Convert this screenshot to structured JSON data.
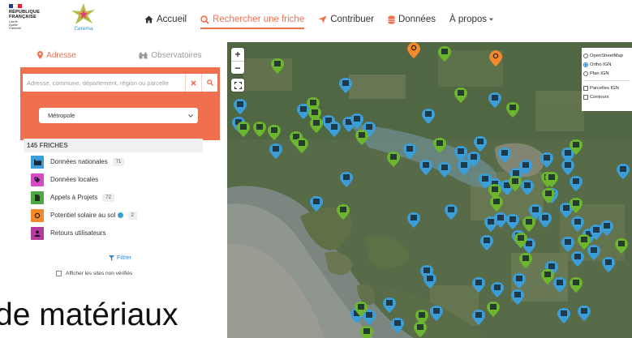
{
  "brand": {
    "rf_lines": [
      "RÉPUBLIQUE",
      "FRANÇAISE"
    ],
    "rf_motto": [
      "Liberté",
      "Égalité",
      "Fraternité"
    ],
    "cerema": "Cerema",
    "colors": {
      "accent": "#ef6f4f",
      "blue": "#3b9ed8",
      "green": "#6bb52f"
    }
  },
  "nav": {
    "items": [
      {
        "label": "Accueil",
        "icon": "home-icon"
      },
      {
        "label": "Rechercher une friche",
        "icon": "search-icon",
        "active": true
      },
      {
        "label": "Contribuer",
        "icon": "send-icon"
      },
      {
        "label": "Données",
        "icon": "database-icon"
      },
      {
        "label": "À propos",
        "icon": "chevron-down-icon"
      }
    ]
  },
  "sidebar": {
    "tabs": [
      {
        "label": "Adresse",
        "icon": "map-marker-icon",
        "active": true
      },
      {
        "label": "Observatoires",
        "icon": "binoculars-icon"
      }
    ],
    "search": {
      "placeholder": "Adresse, commune, département, région ou parcelle"
    },
    "region": {
      "selected": "Métropole"
    },
    "legend": {
      "title": "145 FRICHES",
      "items": [
        {
          "label": "Données nationales",
          "count": "71",
          "color": "#3b9ed8",
          "icon": "factory-icon"
        },
        {
          "label": "Données locales",
          "count": "",
          "color": "#d54cc4",
          "icon": "tag-icon"
        },
        {
          "label": "Appels à Projets",
          "count": "72",
          "color": "#4caa45",
          "icon": "document-icon"
        },
        {
          "label": "Potentiel solaire au sol",
          "count": "2",
          "color": "#f08a2c",
          "icon": "sun-icon"
        },
        {
          "label": "Retours utilisateurs",
          "count": "",
          "color": "#b33b9f",
          "icon": "user-icon"
        }
      ]
    },
    "filter": "Filtrer",
    "unverified": "Afficher les sites non vérifiés"
  },
  "doc_text": "de matériaux",
  "map": {
    "zoom_in": "+",
    "zoom_out": "−",
    "layers": {
      "base": [
        {
          "label": "OpenStreetMap",
          "selected": false
        },
        {
          "label": "Ortho IGN",
          "selected": true
        },
        {
          "label": "Plan IGN",
          "selected": false
        }
      ],
      "overlays": [
        {
          "label": "Parcelles IGN",
          "checked": false
        },
        {
          "label": "Contours",
          "checked": false
        }
      ]
    }
  }
}
